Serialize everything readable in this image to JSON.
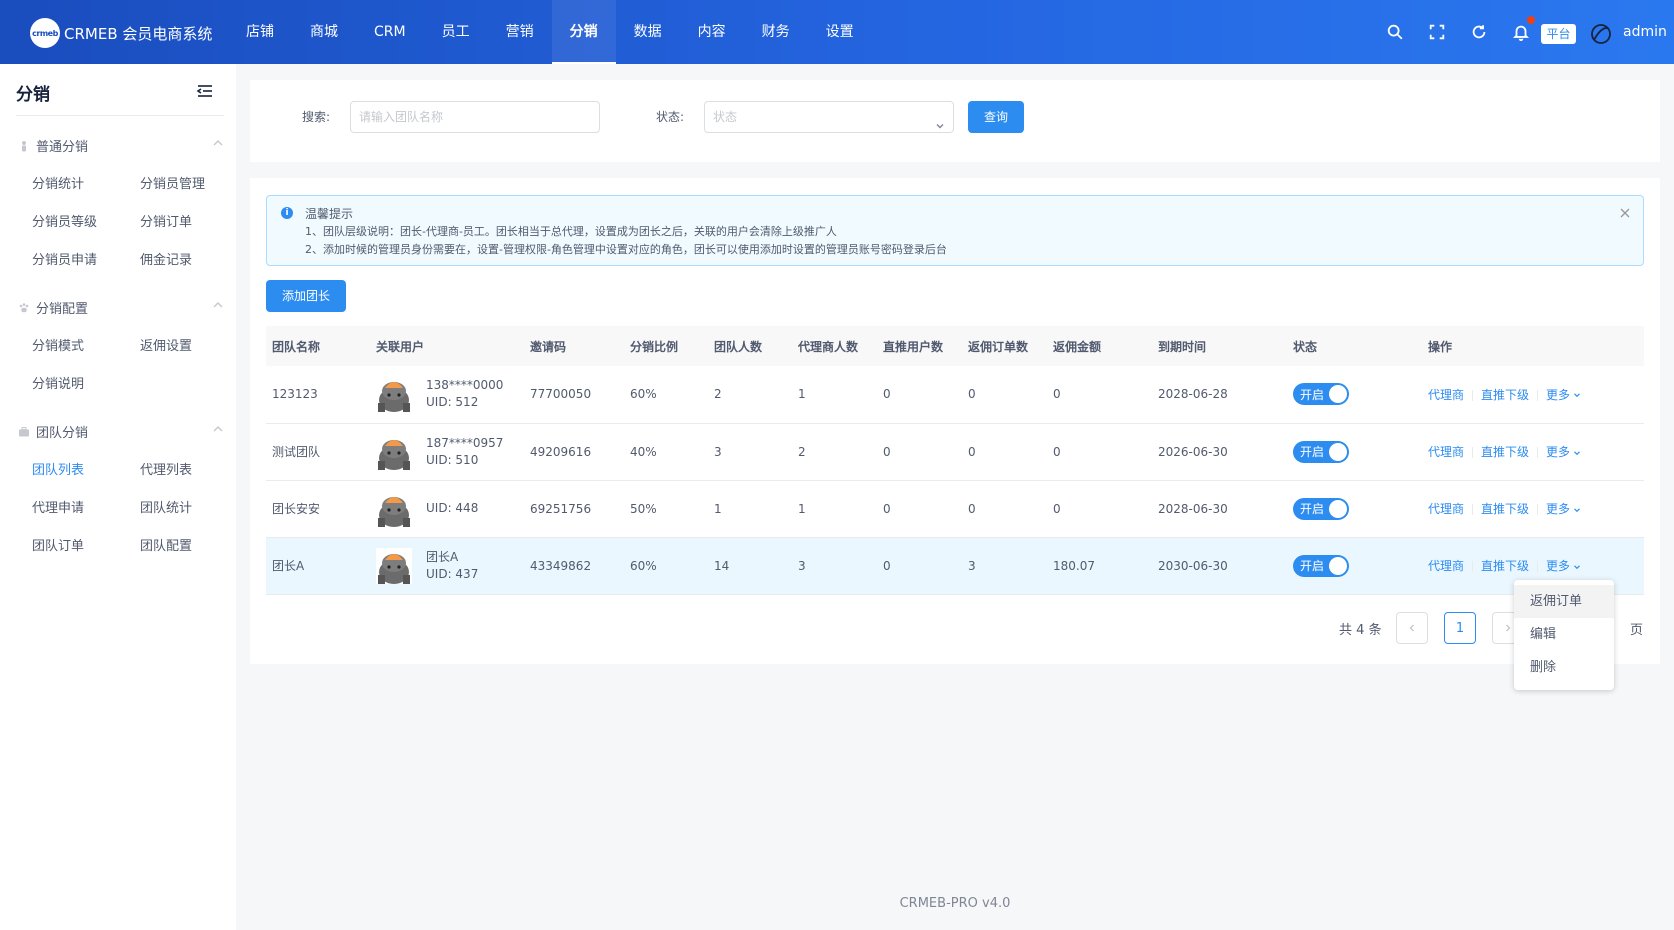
{
  "app": {
    "logo_mark": "crmeb",
    "name": "CRMEB 会员电商系统"
  },
  "topnav": [
    {
      "label": "店铺",
      "active": false
    },
    {
      "label": "商城",
      "active": false
    },
    {
      "label": "CRM",
      "active": false
    },
    {
      "label": "员工",
      "active": false
    },
    {
      "label": "营销",
      "active": false
    },
    {
      "label": "分销",
      "active": true
    },
    {
      "label": "数据",
      "active": false
    },
    {
      "label": "内容",
      "active": false
    },
    {
      "label": "财务",
      "active": false
    },
    {
      "label": "设置",
      "active": false
    }
  ],
  "header_right": {
    "icons": [
      "search-icon",
      "fullscreen-icon",
      "refresh-icon",
      "bell-icon"
    ],
    "platform_badge": "平台",
    "username": "admin"
  },
  "sidebar": {
    "title": "分销",
    "groups": [
      {
        "title": "普通分销",
        "icon": "person-icon",
        "items": [
          "分销统计",
          "分销员管理",
          "分销员等级",
          "分销订单",
          "分销员申请",
          "佣金记录"
        ]
      },
      {
        "title": "分销配置",
        "icon": "paw-icon",
        "items": [
          "分销模式",
          "返佣设置",
          "分销说明"
        ]
      },
      {
        "title": "团队分销",
        "icon": "briefcase-icon",
        "items": [
          "团队列表",
          "代理列表",
          "代理申请",
          "团队统计",
          "团队订单",
          "团队配置"
        ]
      }
    ],
    "active_item": "团队列表"
  },
  "search": {
    "keyword_label": "搜索:",
    "keyword_placeholder": "请输入团队名称",
    "status_label": "状态:",
    "status_placeholder": "状态",
    "query_button": "查询"
  },
  "alert": {
    "title": "温馨提示",
    "lines": [
      "1、团队层级说明：团长-代理商-员工。团长相当于总代理，设置成为团长之后，关联的用户会清除上级推广人",
      "2、添加时候的管理员身份需要在，设置-管理权限-角色管理中设置对应的角色，团长可以使用添加时设置的管理员账号密码登录后台"
    ]
  },
  "add_button": "添加团长",
  "table": {
    "headers": [
      "团队名称",
      "关联用户",
      "邀请码",
      "分销比例",
      "团队人数",
      "代理商人数",
      "直推用户数",
      "返佣订单数",
      "返佣金额",
      "到期时间",
      "状态",
      "操作"
    ],
    "rows": [
      {
        "name": "123123",
        "user_name": "138****0000",
        "uid": "UID: 512",
        "code": "77700050",
        "ratio": "60%",
        "members": "2",
        "agents": "1",
        "direct": "0",
        "orders": "0",
        "amount": "0",
        "expire": "2028-06-28",
        "status": "开启"
      },
      {
        "name": "测试团队",
        "user_name": "187****0957",
        "uid": "UID: 510",
        "code": "49209616",
        "ratio": "40%",
        "members": "3",
        "agents": "2",
        "direct": "0",
        "orders": "0",
        "amount": "0",
        "expire": "2026-06-30",
        "status": "开启"
      },
      {
        "name": "团长安安",
        "user_name": "",
        "uid": "UID: 448",
        "code": "69251756",
        "ratio": "50%",
        "members": "1",
        "agents": "1",
        "direct": "0",
        "orders": "0",
        "amount": "0",
        "expire": "2028-06-30",
        "status": "开启"
      },
      {
        "name": "团长A",
        "user_name": "团长A",
        "uid": "UID: 437",
        "code": "43349862",
        "ratio": "60%",
        "members": "14",
        "agents": "3",
        "direct": "0",
        "orders": "3",
        "amount": "180.07",
        "expire": "2030-06-30",
        "status": "开启"
      }
    ],
    "ops": {
      "agent": "代理商",
      "direct": "直推下级",
      "more": "更多"
    }
  },
  "pagination": {
    "total": "共 4 条",
    "current": "1",
    "page_suffix": "页"
  },
  "dropdown": [
    "返佣订单",
    "编辑",
    "删除"
  ],
  "footer": "CRMEB-PRO v4.0",
  "colors": {
    "primary": "#2d8cf0",
    "header_from": "#1a4dbe",
    "header_to": "#2a78ef",
    "alert_bg": "#f0faff"
  }
}
